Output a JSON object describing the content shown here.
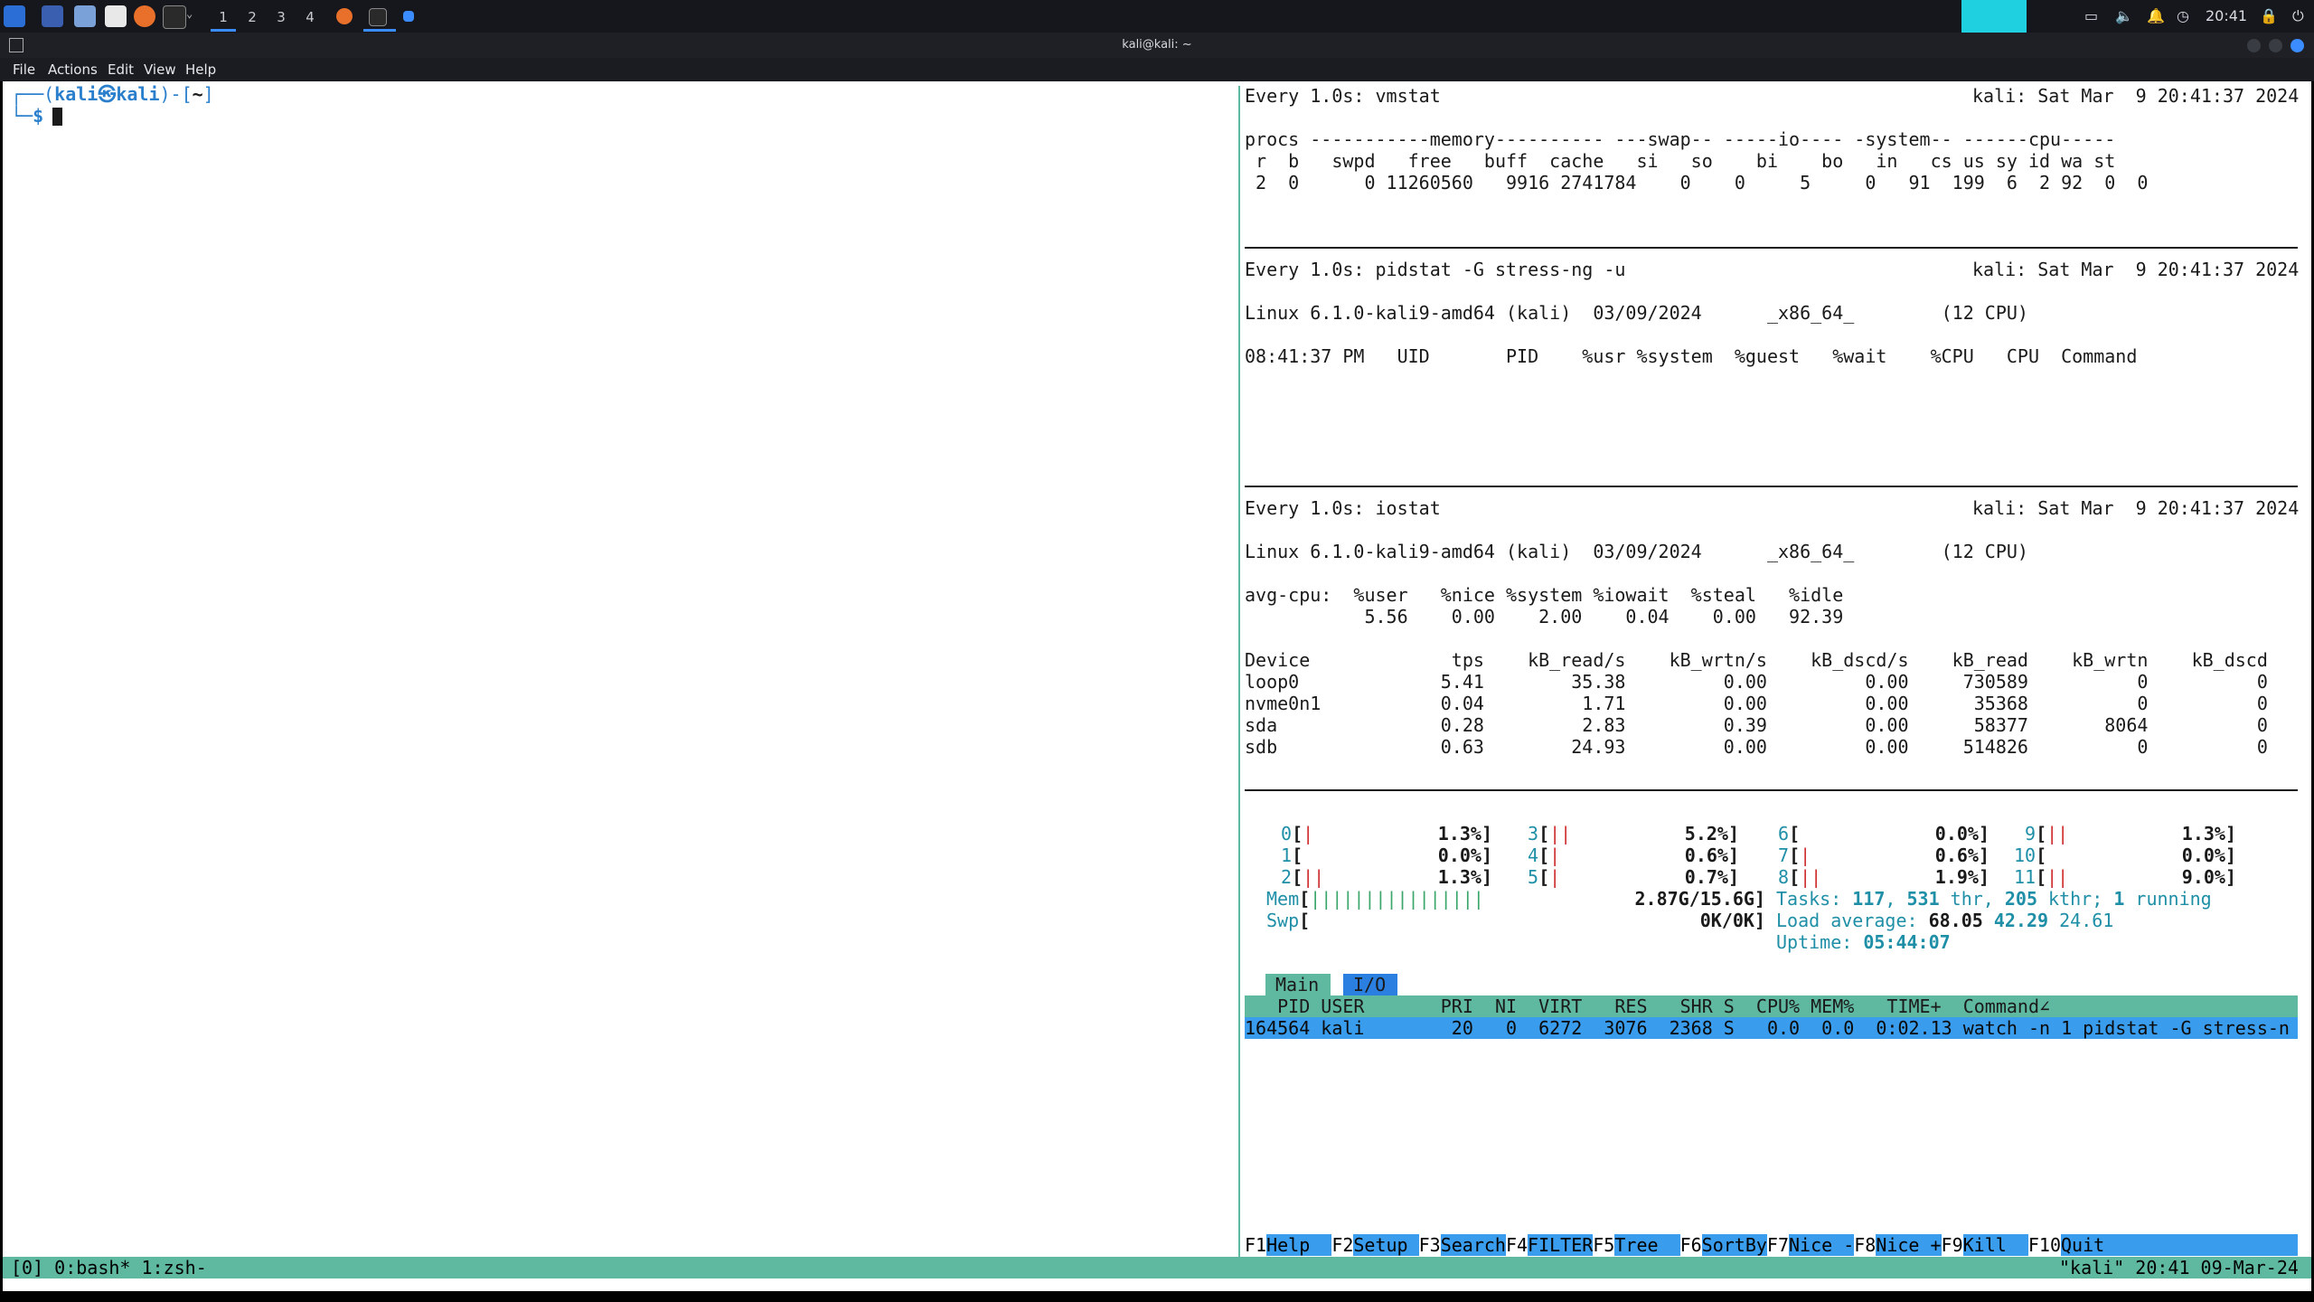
{
  "taskbar": {
    "workspaces": [
      "1",
      "2",
      "3",
      "4"
    ],
    "clock": "20:41"
  },
  "window": {
    "title": "kali@kali: ~"
  },
  "menu": [
    "File",
    "Actions",
    "Edit",
    "View",
    "Help"
  ],
  "left_pane": {
    "prompt_line1_prefix": "┌──(",
    "prompt_user_host": "kali㉿kali",
    "prompt_line1_suffix": ")-[",
    "prompt_dir": "~",
    "prompt_close": "]",
    "prompt_line2": "└─$ "
  },
  "vmstat": {
    "header_left": "Every 1.0s: vmstat",
    "header_right": "kali: Sat Mar  9 20:41:37 2024",
    "line1": "procs -----------memory---------- ---swap-- -----io---- -system-- ------cpu-----",
    "line2": " r  b   swpd   free   buff  cache   si   so    bi    bo   in   cs us sy id wa st",
    "line3": " 2  0      0 11260560   9916 2741784    0    0     5     0   91  199  6  2 92  0  0"
  },
  "pidstat": {
    "header_left": "Every 1.0s: pidstat -G stress-ng -u",
    "header_right": "kali: Sat Mar  9 20:41:37 2024",
    "sysline": "Linux 6.1.0-kali9-amd64 (kali)  03/09/2024      _x86_64_        (12 CPU)",
    "columns": "08:41:37 PM   UID       PID    %usr %system  %guest   %wait    %CPU   CPU  Command"
  },
  "iostat": {
    "header_left": "Every 1.0s: iostat",
    "header_right": "kali: Sat Mar  9 20:41:37 2024",
    "sysline": "Linux 6.1.0-kali9-amd64 (kali)  03/09/2024      _x86_64_        (12 CPU)",
    "avg_hdr": "avg-cpu:  %user   %nice %system %iowait  %steal   %idle",
    "avg_vals": "           5.56    0.00    2.00    0.04    0.00   92.39",
    "dev_hdr": "Device             tps    kB_read/s    kB_wrtn/s    kB_dscd/s    kB_read    kB_wrtn    kB_dscd",
    "rows": [
      "loop0             5.41        35.38         0.00         0.00     730589          0          0",
      "nvme0n1           0.04         1.71         0.00         0.00      35368          0          0",
      "sda               0.28         2.83         0.39         0.00      58377       8064          0",
      "sdb               0.63        24.93         0.00         0.00     514826          0          0"
    ]
  },
  "htop": {
    "cpus": [
      {
        "id": "0",
        "bar": "|",
        "pct": "1.3%"
      },
      {
        "id": "1",
        "bar": "",
        "pct": "0.0%"
      },
      {
        "id": "2",
        "bar": "||",
        "pct": "1.3%"
      },
      {
        "id": "3",
        "bar": "||",
        "pct": "5.2%"
      },
      {
        "id": "4",
        "bar": "|",
        "pct": "0.6%"
      },
      {
        "id": "5",
        "bar": "|",
        "pct": "0.7%"
      },
      {
        "id": "6",
        "bar": "",
        "pct": "0.0%"
      },
      {
        "id": "7",
        "bar": "|",
        "pct": "0.6%"
      },
      {
        "id": "8",
        "bar": "||",
        "pct": "1.9%"
      },
      {
        "id": "9",
        "bar": "||",
        "pct": "1.3%"
      },
      {
        "id": "10",
        "bar": "",
        "pct": "0.0%"
      },
      {
        "id": "11",
        "bar": "||",
        "pct": "9.0%"
      }
    ],
    "mem_label": "Mem",
    "mem_bar": "||||||||||||||||",
    "mem_val": "2.87G/15.6G",
    "swp_label": "Swp",
    "swp_val": "0K/0K",
    "tasks_label": "Tasks: ",
    "tasks": "117",
    "thr_sep": ", ",
    "thr": "531",
    "thr_label": " thr, ",
    "kthr": "205",
    "kthr_label": " kthr; ",
    "running": "1",
    "running_label": " running",
    "load_label": "Load average: ",
    "load1": "68.05",
    "load5": "42.29",
    "load15": "24.61",
    "uptime_label": "Uptime: ",
    "uptime": "05:44:07",
    "tab_main": "Main",
    "tab_io": "I/O",
    "table_header": "   PID USER       PRI  NI  VIRT   RES   SHR S  CPU% MEM%   TIME+  Command",
    "table_sort_marker": "∠",
    "row": "164564 kali        20   0  6272  3076  2368 S   0.0  0.0  0:02.13 watch -n 1 pidstat -G stress-n",
    "fkeys": [
      {
        "k": "F1",
        "l": "Help  "
      },
      {
        "k": "F2",
        "l": "Setup "
      },
      {
        "k": "F3",
        "l": "Search"
      },
      {
        "k": "F4",
        "l": "FILTER"
      },
      {
        "k": "F5",
        "l": "Tree  "
      },
      {
        "k": "F6",
        "l": "SortBy"
      },
      {
        "k": "F7",
        "l": "Nice -"
      },
      {
        "k": "F8",
        "l": "Nice +"
      },
      {
        "k": "F9",
        "l": "Kill  "
      },
      {
        "k": "F10",
        "l": "Quit"
      }
    ]
  },
  "tmux": {
    "left": "[0] 0:bash* 1:zsh-",
    "right": "\"kali\" 20:41 09-Mar-24"
  }
}
